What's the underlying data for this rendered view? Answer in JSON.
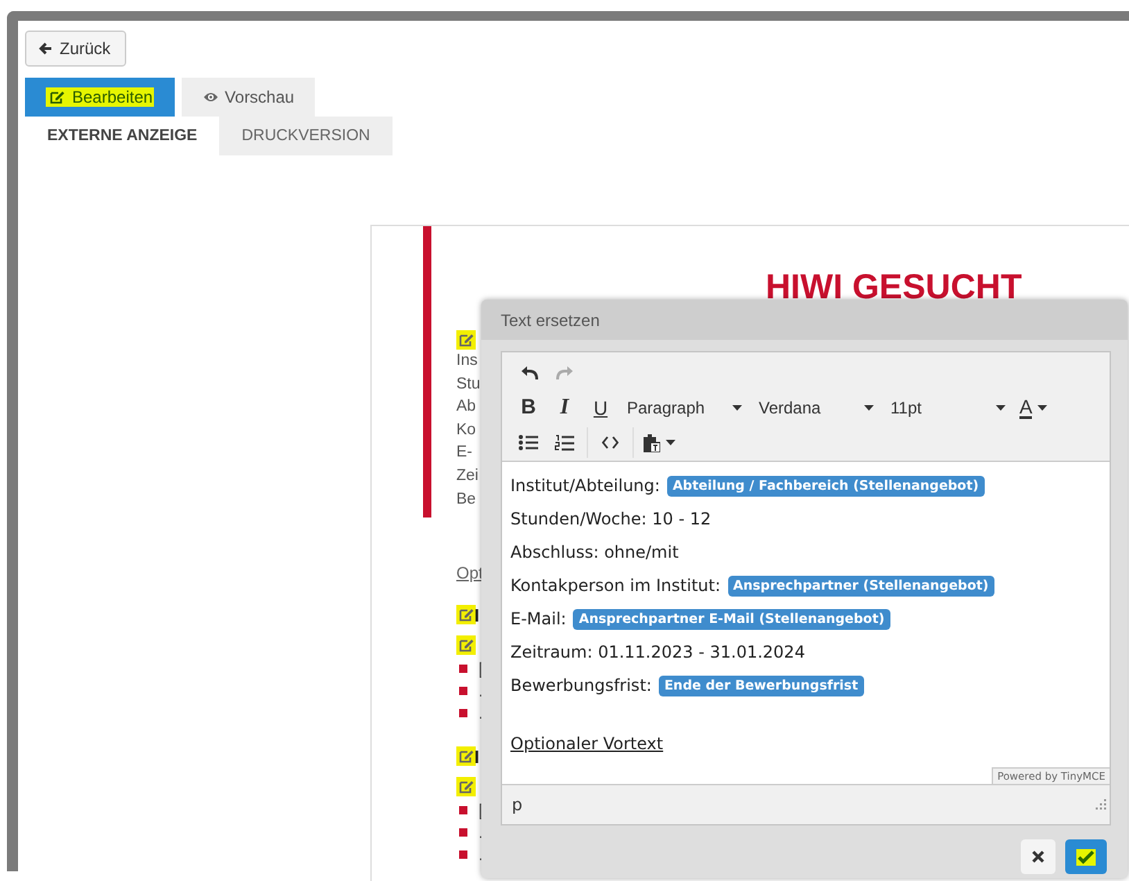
{
  "back_button": {
    "label": "Zurück"
  },
  "mode_tabs": [
    {
      "label": "Bearbeiten",
      "selected": true
    },
    {
      "label": "Vorschau",
      "selected": false
    }
  ],
  "view_tabs": [
    {
      "label": "EXTERNE ANZEIGE",
      "selected": true
    },
    {
      "label": "DRUCKVERSION",
      "selected": false
    }
  ],
  "document": {
    "headline": "HIWI GESUCHT",
    "field_lines": [
      "Ins",
      "Stu",
      "Ab",
      "Ko",
      "E-",
      "Zei",
      "Be"
    ],
    "link": "Opt",
    "sections": [
      {
        "heading": "I",
        "items": [
          "[",
          ".",
          "."
        ]
      },
      {
        "heading": "I",
        "items": [
          "[",
          ".",
          "."
        ]
      }
    ]
  },
  "dialog": {
    "title": "Text ersetzen",
    "history": [
      {
        "kind": "undo",
        "disabled": false
      },
      {
        "kind": "redo",
        "disabled": true
      }
    ],
    "format_buttons": [
      {
        "kind": "bold",
        "label": "B"
      },
      {
        "kind": "italic",
        "label": "I"
      },
      {
        "kind": "underline",
        "label": "U"
      }
    ],
    "selects": [
      {
        "value": "Paragraph"
      },
      {
        "value": "Verdana"
      },
      {
        "value": "11pt"
      }
    ],
    "color_button": {
      "label": "A"
    },
    "paragraphs": [
      {
        "kind": "field",
        "text": "Institut/Abteilung:",
        "tag": "Abteilung / Fachbereich (Stellenangebot)"
      },
      {
        "kind": "field",
        "text": "Stunden/Woche: 10 - 12"
      },
      {
        "kind": "field",
        "text": "Abschluss: ohne/mit"
      },
      {
        "kind": "field",
        "text": "Kontakperson im Institut:",
        "tag": "Ansprechpartner (Stellenangebot)"
      },
      {
        "kind": "field",
        "text": "E-Mail:",
        "tag": "Ansprechpartner E-Mail (Stellenangebot)"
      },
      {
        "kind": "field",
        "text": "Zeitraum: 01.11.2023 - 31.01.2024"
      },
      {
        "kind": "field",
        "text": "Bewerbungsfrist:",
        "tag": "Ende der Bewerbungsfrist"
      },
      {
        "kind": "link",
        "text": "Optionaler Vortext"
      }
    ],
    "branding": "Powered by TinyMCE",
    "path": "p"
  }
}
